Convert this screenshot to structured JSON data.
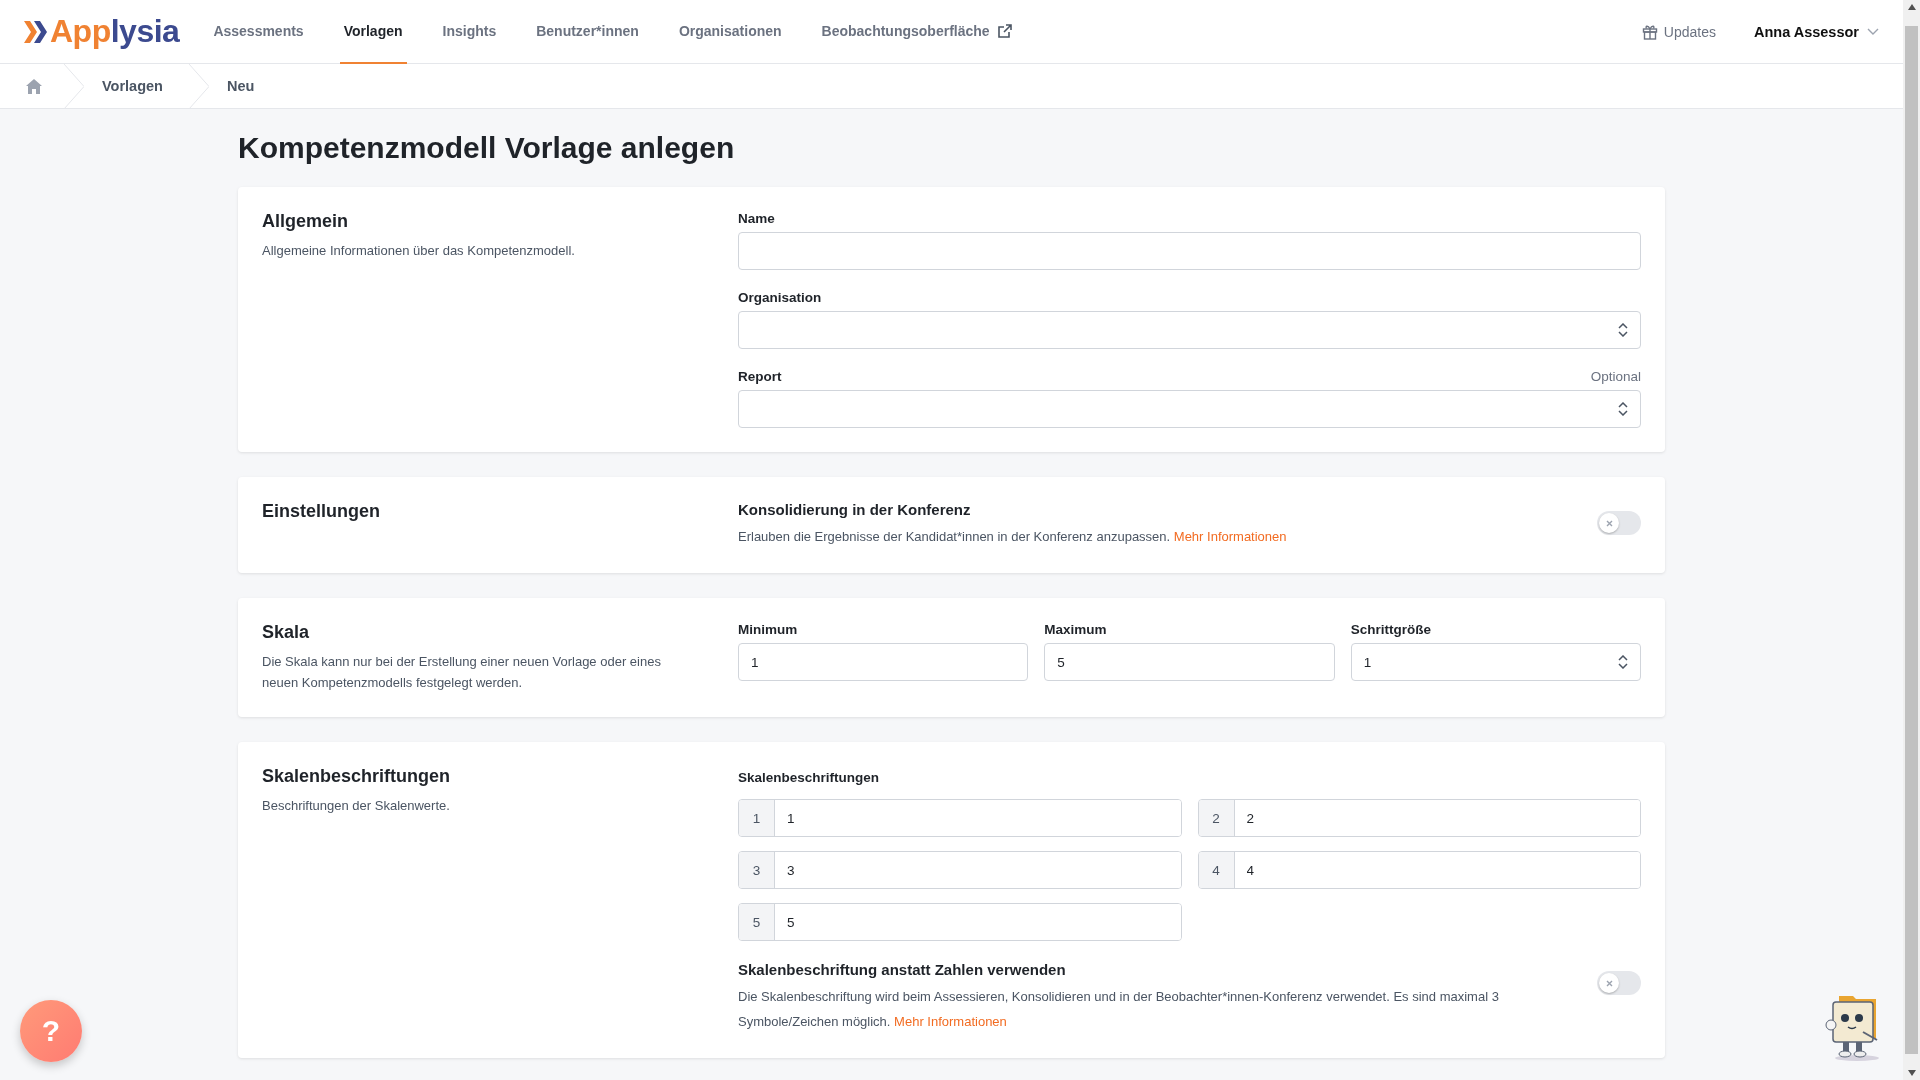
{
  "logo": {
    "accent": "App",
    "rest": "lysia"
  },
  "nav": [
    {
      "label": "Assessments",
      "selected": false,
      "external": false
    },
    {
      "label": "Vorlagen",
      "selected": true,
      "external": false
    },
    {
      "label": "Insights",
      "selected": false,
      "external": false
    },
    {
      "label": "Benutzer*innen",
      "selected": false,
      "external": false
    },
    {
      "label": "Organisationen",
      "selected": false,
      "external": false
    },
    {
      "label": "Beobachtungsoberfläche",
      "selected": false,
      "external": true
    }
  ],
  "updates": "Updates",
  "user": "Anna Assessor",
  "breadcrumb": [
    "Vorlagen",
    "Neu"
  ],
  "title": "Kompetenzmodell Vorlage anlegen",
  "general": {
    "title": "Allgemein",
    "description": "Allgemeine Informationen über das Kompetenzmodell.",
    "fields": [
      {
        "kind": "text",
        "label": "Name"
      },
      {
        "kind": "select",
        "label": "Organisation"
      },
      {
        "kind": "select",
        "label": "Report",
        "hint": "Optional"
      }
    ]
  },
  "settings": {
    "title": "Einstellungen",
    "option": {
      "title": "Konsolidierung in der Konferenz",
      "text": "Erlauben die Ergebnisse der Kandidat*innen in der Konferenz anzupassen.",
      "link": "Mehr Informationen",
      "on": false
    }
  },
  "scale": {
    "title": "Skala",
    "description": "Die Skala kann nur bei der Erstellung einer neuen Vorlage oder eines neuen Kompetenzmodells festgelegt werden.",
    "fields": [
      {
        "kind": "text",
        "label": "Minimum",
        "value": "1"
      },
      {
        "kind": "text",
        "label": "Maximum",
        "value": "5"
      },
      {
        "kind": "select",
        "label": "Schrittgröße",
        "value": "1"
      }
    ]
  },
  "labels": {
    "title": "Skalenbeschriftungen",
    "description": "Beschriftungen der Skalenwerte.",
    "heading": "Skalenbeschriftungen",
    "items": [
      {
        "number": "1",
        "value": "1"
      },
      {
        "number": "2",
        "value": "2"
      },
      {
        "number": "3",
        "value": "3"
      },
      {
        "number": "4",
        "value": "4"
      },
      {
        "number": "5",
        "value": "5"
      }
    ],
    "option": {
      "title": "Skalenbeschriftung anstatt Zahlen verwenden",
      "text": "Die Skalenbeschriftung wird beim Assessieren, Konsolidieren und in der Beobachter*innen-Konferenz verwendet. Es sind maximal 3 Symbole/Zeichen möglich.",
      "link": "Mehr Informationen",
      "on": false
    }
  },
  "help": "?"
}
